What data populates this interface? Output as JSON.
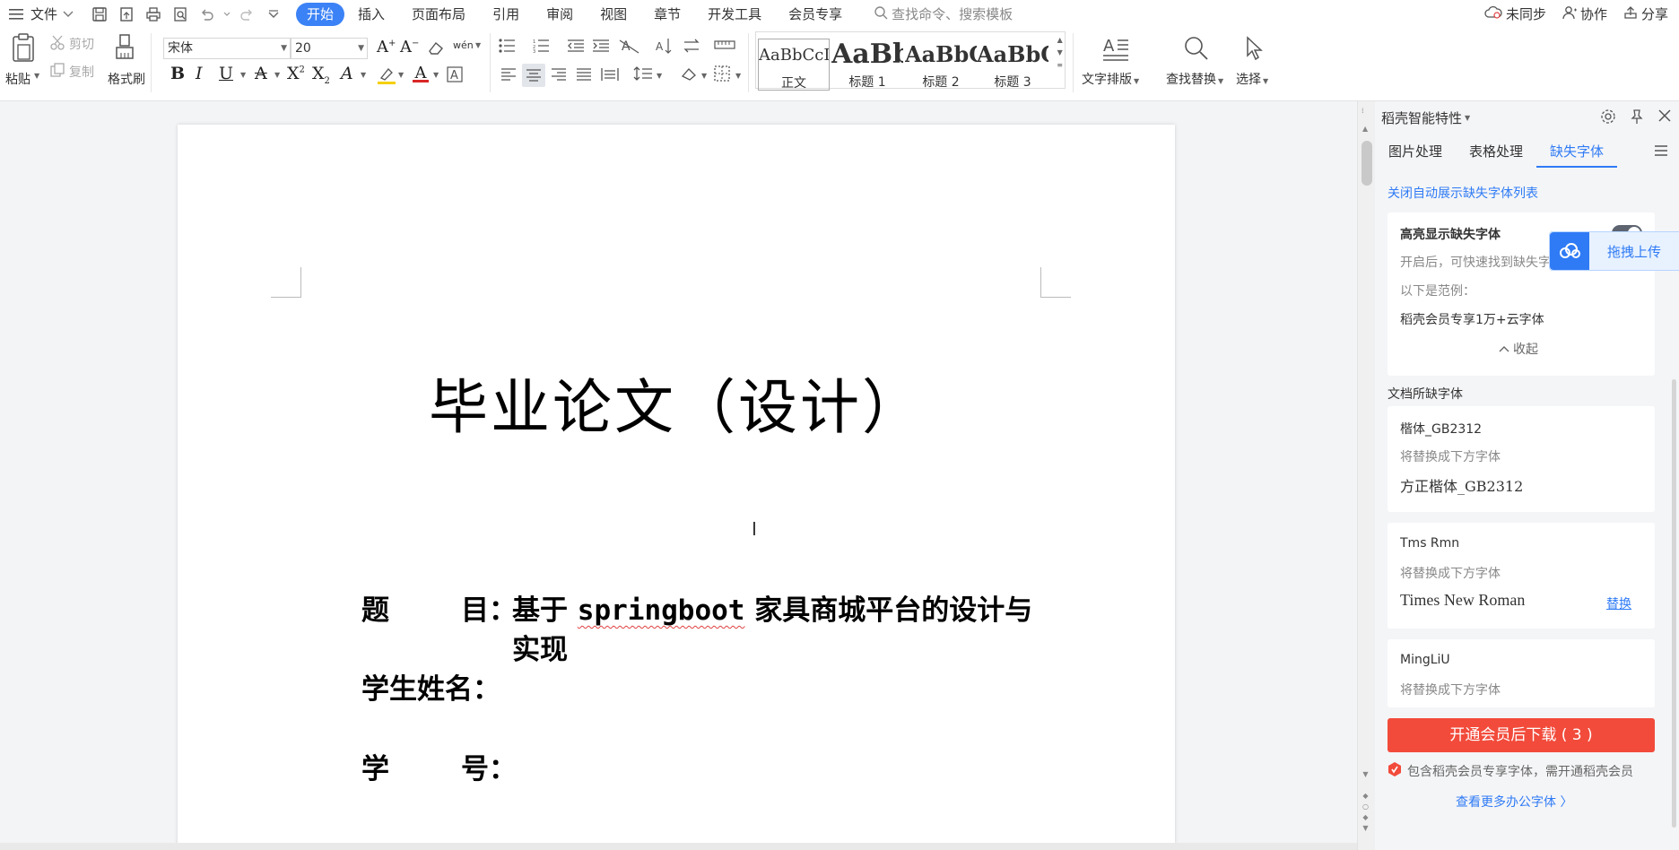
{
  "menubar": {
    "file_label": "文件",
    "tabs": [
      {
        "label": "开始",
        "active": true
      },
      {
        "label": "插入"
      },
      {
        "label": "页面布局"
      },
      {
        "label": "引用"
      },
      {
        "label": "审阅"
      },
      {
        "label": "视图"
      },
      {
        "label": "章节"
      },
      {
        "label": "开发工具"
      },
      {
        "label": "会员专享"
      }
    ],
    "search_placeholder": "查找命令、搜索模板",
    "right": {
      "sync": "未同步",
      "collab": "协作",
      "share": "分享"
    },
    "accent": "#3b82f6"
  },
  "ribbon": {
    "paste": "粘贴",
    "cut": "剪切",
    "copy": "复制",
    "format_painter": "格式刷",
    "font_name": "宋体",
    "font_size": "20",
    "phonetic": "wén",
    "styles": [
      {
        "sample": "AaBbCcDd",
        "name": "正文"
      },
      {
        "sample": "AaBb",
        "name": "标题 1"
      },
      {
        "sample": "AaBbC",
        "name": "标题 2"
      },
      {
        "sample": "AaBbC",
        "name": "标题 3"
      }
    ],
    "text_layout": "文字排版",
    "find_replace": "查找替换",
    "select": "选择"
  },
  "document": {
    "title": "毕业论文（设计）",
    "topic_label_a": "题",
    "topic_label_b": "目：",
    "topic_prefix": "基于",
    "topic_word": "springboot",
    "topic_suffix": "家具商城平台的设计与",
    "topic_line2": "实现",
    "student_label": "学生姓名：",
    "id_label_a": "学",
    "id_label_b": "号："
  },
  "panel": {
    "title": "稻壳智能特性",
    "tabs": [
      "图片处理",
      "表格处理",
      "缺失字体"
    ],
    "active_tab": 2,
    "close_auto_link": "关闭自动展示缺失字体列表",
    "highlight": {
      "title": "高亮显示缺失字体",
      "desc": "开启后，可快速找到缺失字",
      "example_label": "以下是范例：",
      "example": "稻壳会员专享1万+云字体",
      "collapse": "收起"
    },
    "upload_float": "拖拽上传",
    "missing_heading": "文档所缺字体",
    "fonts": [
      {
        "name": "楷体_GB2312",
        "replace_label": "将替换成下方字体",
        "replacement": "方正楷体_GB2312"
      },
      {
        "name": "Tms Rmn",
        "replace_label": "将替换成下方字体",
        "replacement": "Times New Roman",
        "action": "替换"
      },
      {
        "name": "MingLiU",
        "replace_label": "将替换成下方字体"
      }
    ],
    "download_button": "开通会员后下载 ( 3 )",
    "notice": "包含稻壳会员专享字体，需开通稻壳会员",
    "more_link": "查看更多办公字体 〉",
    "colors": {
      "link": "#2f7bf5",
      "download": "#f24b3b"
    }
  }
}
